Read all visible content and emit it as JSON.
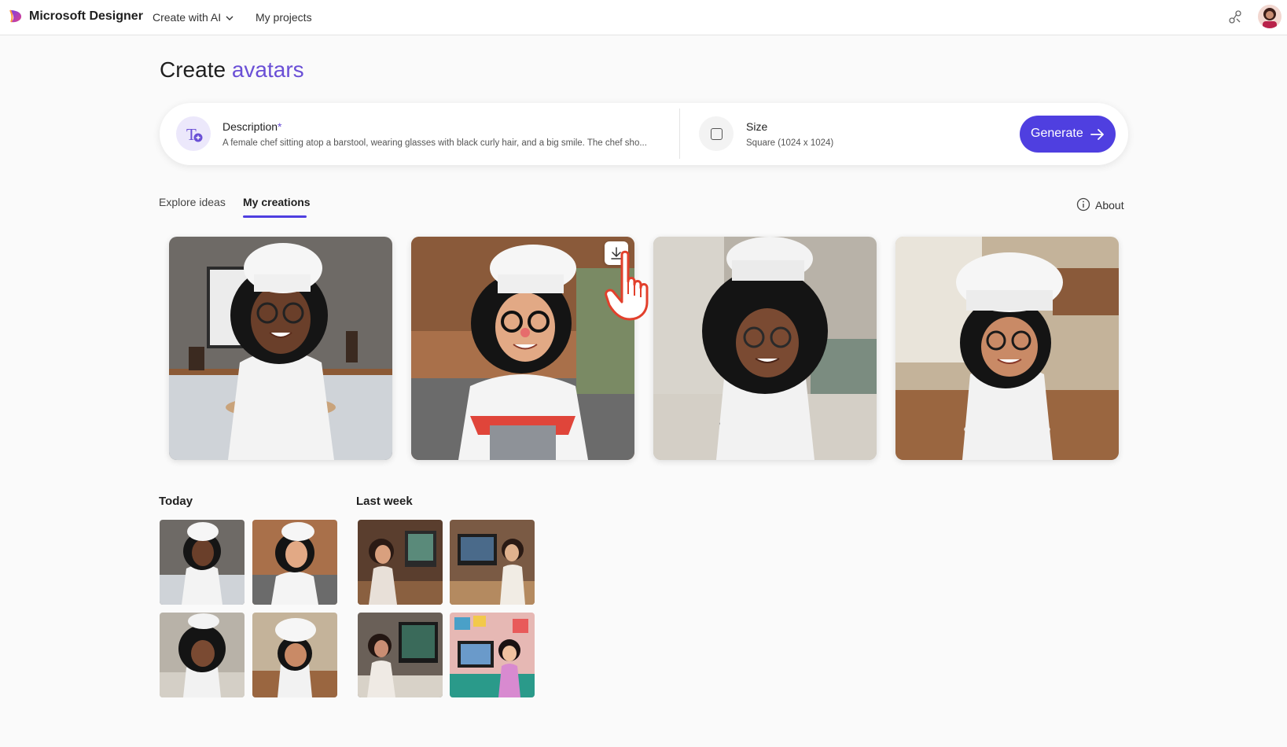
{
  "app": {
    "brand": "Microsoft Designer"
  },
  "nav": {
    "create_with_ai": "Create with AI",
    "my_projects": "My projects"
  },
  "page": {
    "title_prefix": "Create",
    "title_accent": "avatars"
  },
  "prompt": {
    "description_label": "Description",
    "required_marker": "*",
    "description_value": "A female chef sitting atop a barstool, wearing glasses with black curly hair, and a big smile. The chef sho...",
    "size_label": "Size",
    "size_value": "Square (1024 x 1024)",
    "generate_label": "Generate"
  },
  "tabs": {
    "explore": "Explore ideas",
    "creations": "My creations",
    "about": "About"
  },
  "history": {
    "today_label": "Today",
    "last_week_label": "Last week"
  },
  "colors": {
    "accent": "#4f3fe0",
    "title_accent": "#6a4fd6"
  },
  "icons": [
    "designer-logo-icon",
    "chevron-down-icon",
    "share-icon",
    "text-prompt-icon",
    "square-size-icon",
    "arrow-right-icon",
    "info-icon",
    "download-icon",
    "hand-cursor-icon"
  ]
}
